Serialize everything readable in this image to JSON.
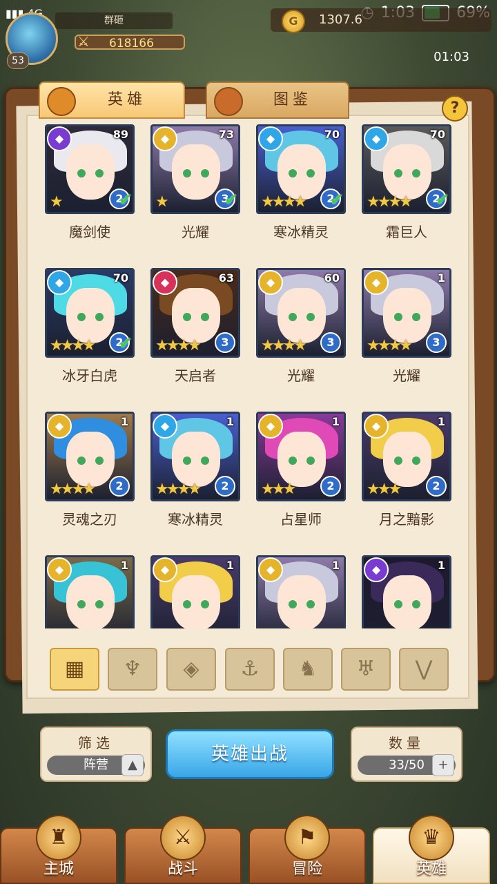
{
  "statusbar": {
    "network": "4G",
    "time": "1:03",
    "battery": "69%"
  },
  "player": {
    "name": "群砸",
    "level": "53",
    "power": "618166",
    "gold": "1307.6"
  },
  "timer": "01:03",
  "tabs": [
    {
      "label": "英雄",
      "active": true
    },
    {
      "label": "图鉴",
      "active": false
    }
  ],
  "help_label": "?",
  "heroes": [
    {
      "name": "魔剑使",
      "level": "89",
      "faction": "purple",
      "stars": 1,
      "grade": "2",
      "checked": true,
      "hair": "#e9e9ef",
      "bg": "#2e2a3a"
    },
    {
      "name": "光耀",
      "level": "73",
      "faction": "gold",
      "stars": 1,
      "grade": "3",
      "checked": true,
      "hair": "#c9c9dd",
      "bg": "#8e7aa8"
    },
    {
      "name": "寒冰精灵",
      "level": "70",
      "faction": "blue",
      "stars": 4,
      "grade": "2",
      "checked": true,
      "hair": "#5fc6e6",
      "bg": "#4a5fd0"
    },
    {
      "name": "霜巨人",
      "level": "70",
      "faction": "blue",
      "stars": 4,
      "grade": "2",
      "checked": true,
      "hair": "#d9d9d9",
      "bg": "#5a5a5a"
    },
    {
      "name": "冰牙白虎",
      "level": "70",
      "faction": "blue",
      "stars": 4,
      "grade": "2",
      "checked": true,
      "hair": "#4fdbe6",
      "bg": "#2a3a66"
    },
    {
      "name": "天启者",
      "level": "63",
      "faction": "red",
      "stars": 4,
      "grade": "3",
      "checked": false,
      "hair": "#7a4a22",
      "bg": "#4a2a1a"
    },
    {
      "name": "光耀",
      "level": "60",
      "faction": "gold",
      "stars": 4,
      "grade": "3",
      "checked": false,
      "hair": "#c9c9dd",
      "bg": "#8e7aa8"
    },
    {
      "name": "光耀",
      "level": "1",
      "faction": "gold",
      "stars": 4,
      "grade": "3",
      "checked": false,
      "hair": "#c9c9dd",
      "bg": "#8e7aa8"
    },
    {
      "name": "灵魂之刃",
      "level": "1",
      "faction": "gold",
      "stars": 4,
      "grade": "2",
      "checked": false,
      "hair": "#2f8ee0",
      "bg": "#a07a4a"
    },
    {
      "name": "寒冰精灵",
      "level": "1",
      "faction": "blue",
      "stars": 4,
      "grade": "2",
      "checked": false,
      "hair": "#5fc6e6",
      "bg": "#4a5fd0"
    },
    {
      "name": "占星师",
      "level": "1",
      "faction": "gold",
      "stars": 3,
      "grade": "2",
      "checked": false,
      "hair": "#e04ab6",
      "bg": "#8a3a9a"
    },
    {
      "name": "月之黯影",
      "level": "1",
      "faction": "gold",
      "stars": 3,
      "grade": "2",
      "checked": false,
      "hair": "#f2cd4a",
      "bg": "#4a3a6a"
    },
    {
      "name": "",
      "level": "1",
      "faction": "gold",
      "stars": 0,
      "grade": "",
      "checked": false,
      "hair": "#38c2d6",
      "bg": "#7a6a4a"
    },
    {
      "name": "",
      "level": "1",
      "faction": "gold",
      "stars": 0,
      "grade": "",
      "checked": false,
      "hair": "#f2cd4a",
      "bg": "#4a3a6a"
    },
    {
      "name": "",
      "level": "1",
      "faction": "gold",
      "stars": 0,
      "grade": "",
      "checked": false,
      "hair": "#c9c9dd",
      "bg": "#8e7aa8"
    },
    {
      "name": "",
      "level": "1",
      "faction": "purple",
      "stars": 0,
      "grade": "",
      "checked": false,
      "hair": "#3a2a5a",
      "bg": "#1e1a2e"
    }
  ],
  "faction_colors": {
    "purple": "#7a3bd1",
    "gold": "#e6b42a",
    "blue": "#2fa6e6",
    "red": "#d8325a"
  },
  "filters": [
    {
      "icon": "grid-icon",
      "glyph": "▦",
      "active": true
    },
    {
      "icon": "flame-icon",
      "glyph": "♆",
      "active": false
    },
    {
      "icon": "diamond-icon",
      "glyph": "◈",
      "active": false
    },
    {
      "icon": "anchor-icon",
      "glyph": "⚓",
      "active": false
    },
    {
      "icon": "beast-icon",
      "glyph": "♞",
      "active": false
    },
    {
      "icon": "demon-icon",
      "glyph": "♅",
      "active": false
    },
    {
      "icon": "chevron-icon",
      "glyph": "⋁",
      "active": false
    }
  ],
  "filter_panel": {
    "title": "筛选",
    "value": "阵营"
  },
  "deploy_label": "英雄出战",
  "count_panel": {
    "title": "数量",
    "value": "33/50"
  },
  "nav": [
    {
      "label": "主城",
      "glyph": "♜",
      "active": false
    },
    {
      "label": "战斗",
      "glyph": "⚔",
      "active": false
    },
    {
      "label": "冒险",
      "glyph": "⚑",
      "active": false
    },
    {
      "label": "英雄",
      "glyph": "♛",
      "active": true
    }
  ]
}
